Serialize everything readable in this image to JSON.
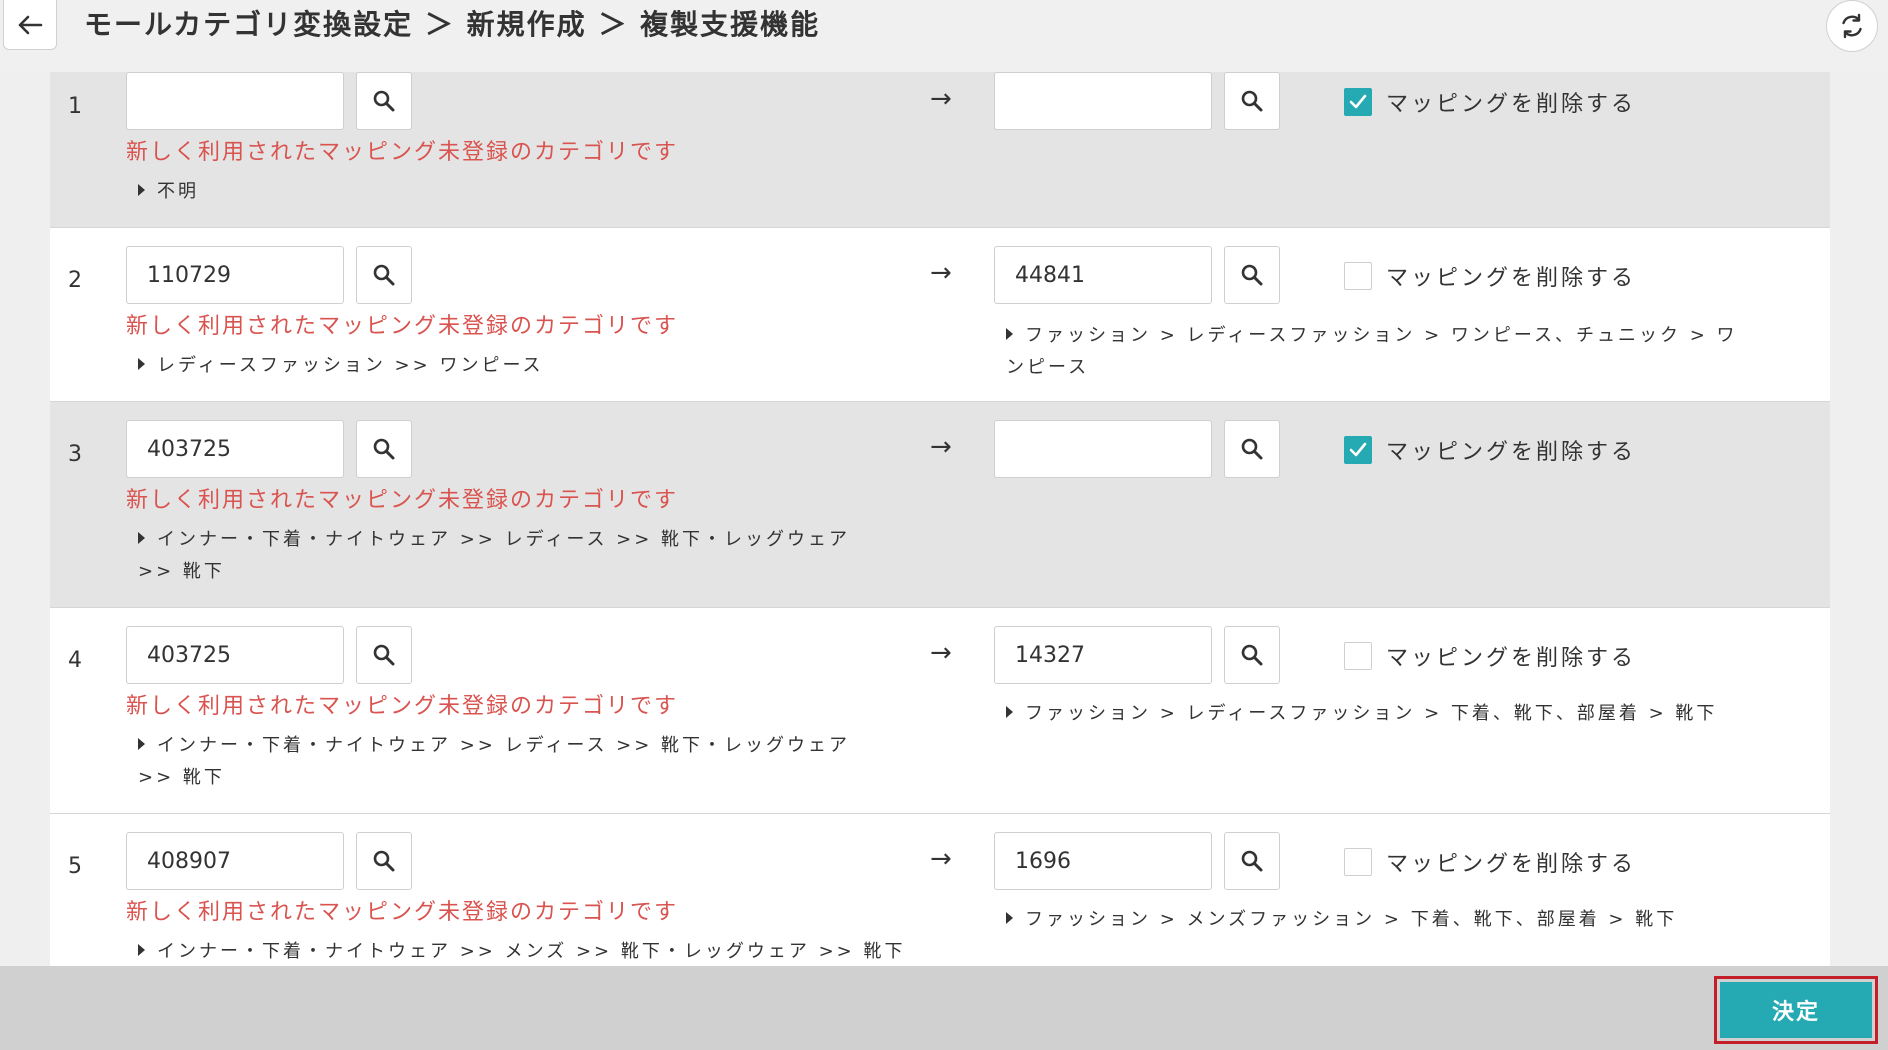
{
  "header": {
    "title": "モールカテゴリ変換設定 ＞ 新規作成 ＞ 複製支援機能"
  },
  "icons": {
    "back": "arrow-left-icon",
    "refresh": "refresh-icon",
    "search": "magnifier-icon",
    "check": "check-icon"
  },
  "colors": {
    "accent": "#25a9b2",
    "warning": "#d9534f",
    "highlight_border": "#c41e2a"
  },
  "rows": [
    {
      "num": "1",
      "left_value": "",
      "right_value": "",
      "arrow": "→",
      "delete_checked": true,
      "delete_label": "マッピングを削除する",
      "warning": "新しく利用されたマッピング未登録のカテゴリです",
      "left_path": "不明",
      "right_path": ""
    },
    {
      "num": "2",
      "left_value": "110729",
      "right_value": "44841",
      "arrow": "→",
      "delete_checked": false,
      "delete_label": "マッピングを削除する",
      "warning": "新しく利用されたマッピング未登録のカテゴリです",
      "left_path": "レディースファッション >> ワンピース",
      "right_path": "ファッション > レディースファッション > ワンピース、チュニック > ワンピース"
    },
    {
      "num": "3",
      "left_value": "403725",
      "right_value": "",
      "arrow": "→",
      "delete_checked": true,
      "delete_label": "マッピングを削除する",
      "warning": "新しく利用されたマッピング未登録のカテゴリです",
      "left_path": "インナー・下着・ナイトウェア >> レディース >> 靴下・レッグウェア >> 靴下",
      "right_path": ""
    },
    {
      "num": "4",
      "left_value": "403725",
      "right_value": "14327",
      "arrow": "→",
      "delete_checked": false,
      "delete_label": "マッピングを削除する",
      "warning": "新しく利用されたマッピング未登録のカテゴリです",
      "left_path": "インナー・下着・ナイトウェア >> レディース >> 靴下・レッグウェア >> 靴下",
      "right_path": "ファッション > レディースファッション > 下着、靴下、部屋着 > 靴下"
    },
    {
      "num": "5",
      "left_value": "408907",
      "right_value": "1696",
      "arrow": "→",
      "delete_checked": false,
      "delete_label": "マッピングを削除する",
      "warning": "新しく利用されたマッピング未登録のカテゴリです",
      "left_path": "インナー・下着・ナイトウェア >> メンズ >> 靴下・レッグウェア >> 靴下",
      "right_path": "ファッション > メンズファッション > 下着、靴下、部屋着 > 靴下"
    }
  ],
  "footer": {
    "submit_label": "決定"
  }
}
